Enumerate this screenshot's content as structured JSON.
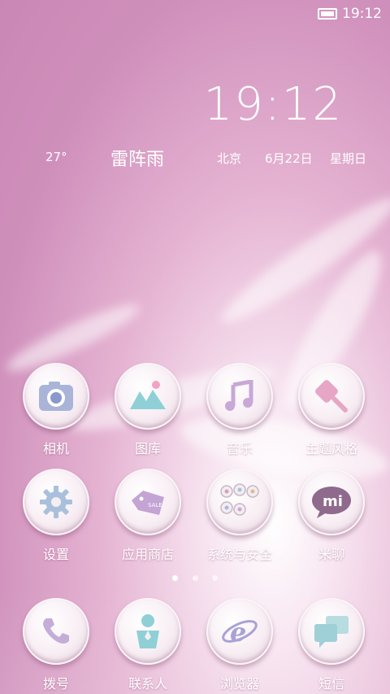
{
  "status_bar": {
    "time": "19:12",
    "battery_icon": "battery-full-icon"
  },
  "widget": {
    "clock": "19:12",
    "temperature": "27°",
    "condition": "雷阵雨",
    "city": "北京",
    "date": "6月22日",
    "weekday": "星期日"
  },
  "apps": [
    {
      "label": "相机",
      "icon": "camera-icon"
    },
    {
      "label": "图库",
      "icon": "gallery-icon"
    },
    {
      "label": "音乐",
      "icon": "music-icon"
    },
    {
      "label": "主题风格",
      "icon": "theme-brush-icon"
    },
    {
      "label": "设置",
      "icon": "gear-icon"
    },
    {
      "label": "应用商店",
      "icon": "app-store-tag-icon"
    },
    {
      "label": "系统与安全",
      "icon": "system-security-icon"
    },
    {
      "label": "米聊",
      "icon": "mi-talk-icon"
    }
  ],
  "page_indicator": {
    "count": 3,
    "active": 0
  },
  "dock": [
    {
      "label": "拨号",
      "icon": "phone-icon"
    },
    {
      "label": "联系人",
      "icon": "contacts-icon"
    },
    {
      "label": "浏览器",
      "icon": "browser-icon"
    },
    {
      "label": "短信",
      "icon": "messages-icon"
    }
  ]
}
